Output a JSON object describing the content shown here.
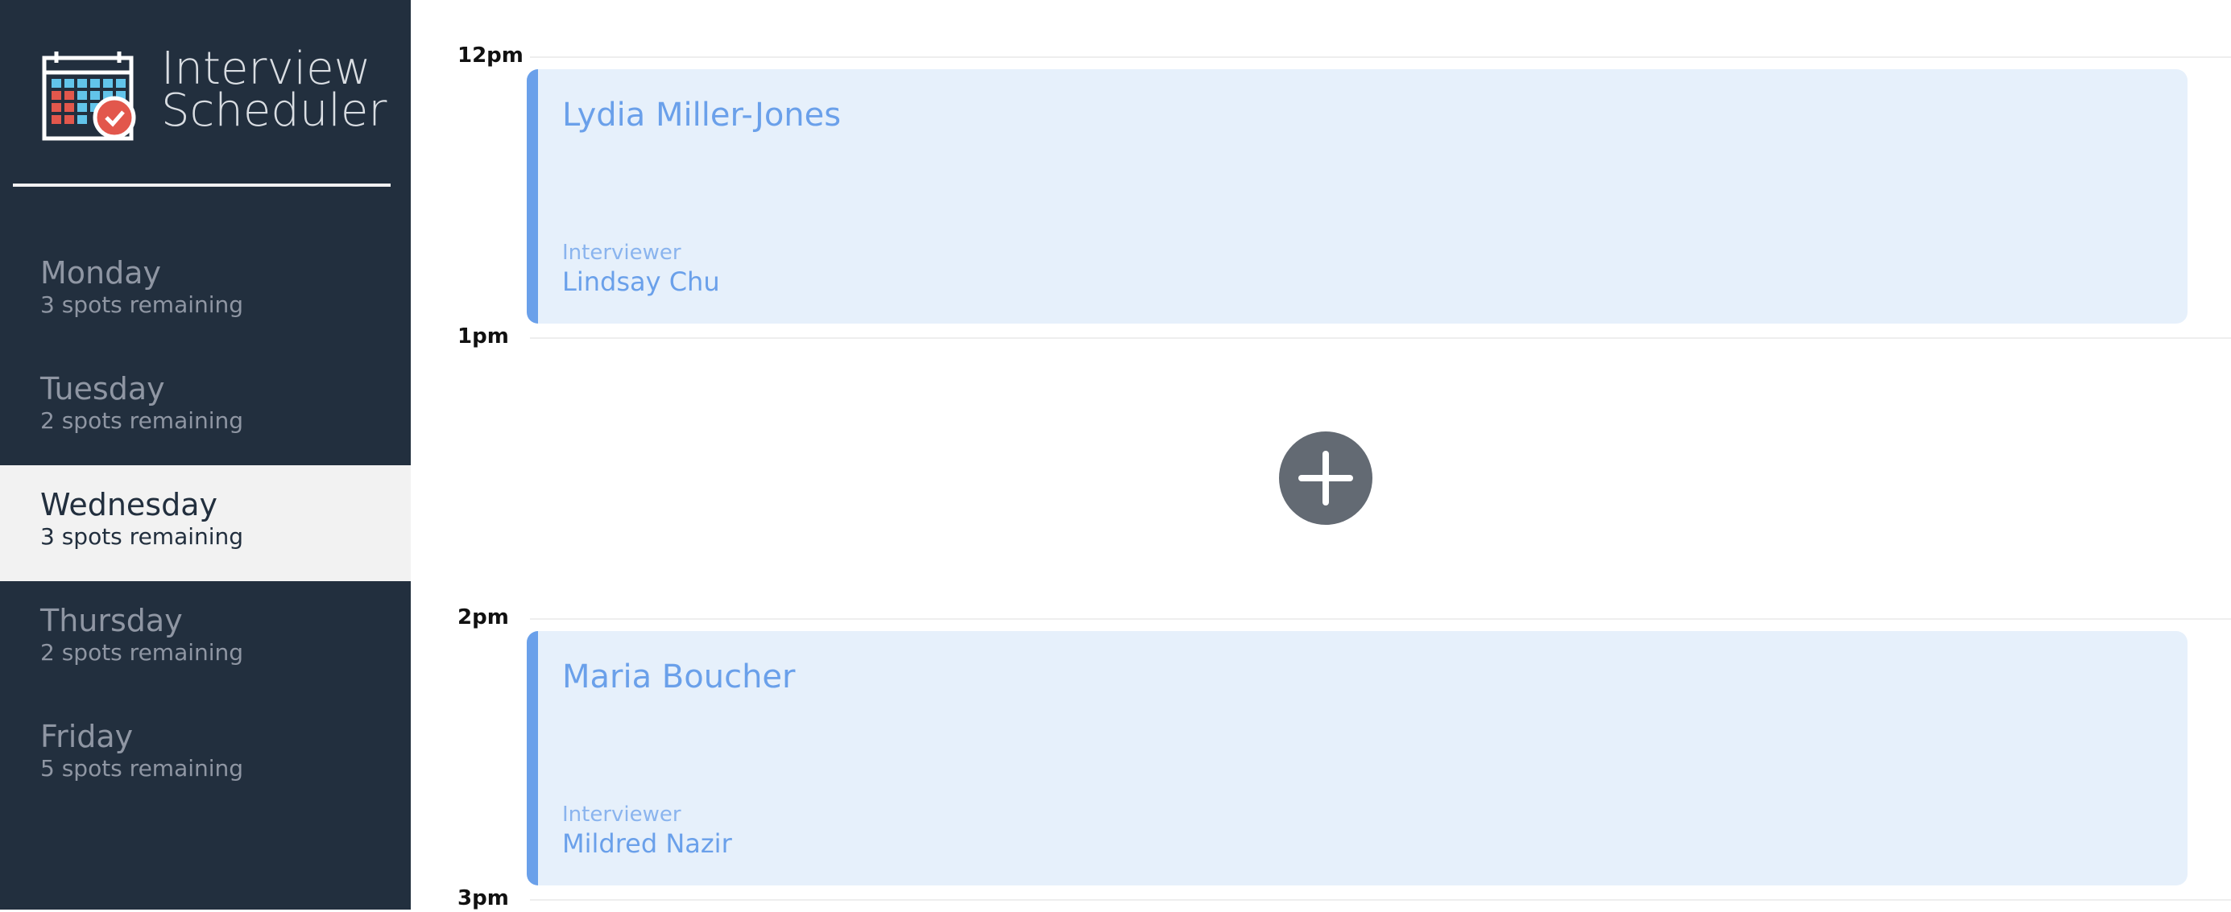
{
  "app": {
    "title_line1": "Interview",
    "title_line2": "Scheduler"
  },
  "days": [
    {
      "name": "Monday",
      "spots": "3 spots remaining"
    },
    {
      "name": "Tuesday",
      "spots": "2 spots remaining"
    },
    {
      "name": "Wednesday",
      "spots": "3 spots remaining",
      "selected": true
    },
    {
      "name": "Thursday",
      "spots": "2 spots remaining"
    },
    {
      "name": "Friday",
      "spots": "5 spots remaining"
    }
  ],
  "schedule": {
    "times": [
      "12pm",
      "1pm",
      "2pm",
      "3pm"
    ],
    "appointments": [
      {
        "student": "Lydia Miller-Jones",
        "interviewer_label": "Interviewer",
        "interviewer": "Lindsay Chu"
      },
      {
        "student": "Maria Boucher",
        "interviewer_label": "Interviewer",
        "interviewer": "Mildred Nazir"
      }
    ]
  },
  "colors": {
    "sidebar": "#222f3e",
    "selected_day_bg": "#f2f2f2",
    "appointment_bg": "#e6f0fb",
    "appointment_accent": "#6aa0ea",
    "add_button": "#636a73"
  },
  "icons": {
    "logo": "calendar-check-icon",
    "add": "plus-icon"
  }
}
